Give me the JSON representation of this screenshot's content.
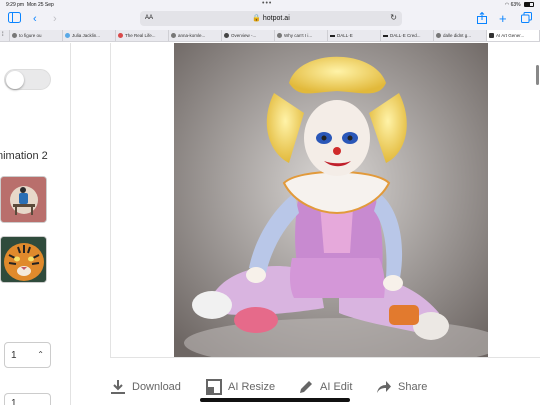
{
  "status": {
    "time": "9:29 pm",
    "date": "Mon 25 Sep",
    "dots": "•••",
    "battery": "63%"
  },
  "browser": {
    "aa": "AA",
    "host": "🔒 hotpot.ai",
    "tabs": [
      {
        "label": "to figure ou"
      },
      {
        "label": "Julia Jacklin..."
      },
      {
        "label": "The Real Life..."
      },
      {
        "label": "anna-komle..."
      },
      {
        "label": "Overview -..."
      },
      {
        "label": "Why can't I i..."
      },
      {
        "label": "DALL·E"
      },
      {
        "label": "DALL·E Cred..."
      },
      {
        "label": "dalle didnt g..."
      },
      {
        "label": "AI Art Gener..."
      }
    ]
  },
  "sidebar": {
    "animation_label": "nimation 2",
    "count_value": "1",
    "second_value": "1"
  },
  "actions": {
    "download": "Download",
    "resize": "AI Resize",
    "edit": "AI Edit",
    "share": "Share"
  },
  "colors": {
    "accent": "#0a84ff",
    "action_text": "#666666"
  }
}
